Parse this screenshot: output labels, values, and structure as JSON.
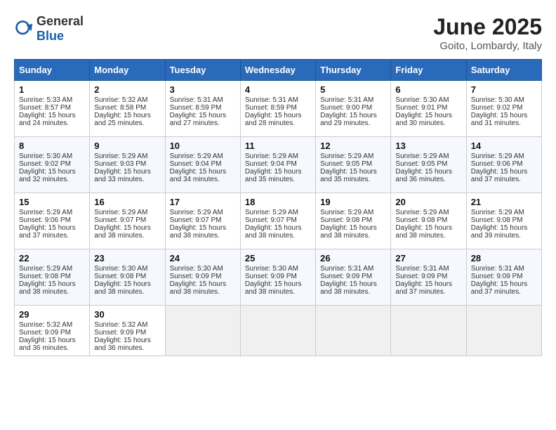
{
  "header": {
    "logo_general": "General",
    "logo_blue": "Blue",
    "month": "June 2025",
    "location": "Goito, Lombardy, Italy"
  },
  "days_of_week": [
    "Sunday",
    "Monday",
    "Tuesday",
    "Wednesday",
    "Thursday",
    "Friday",
    "Saturday"
  ],
  "weeks": [
    [
      {
        "day": "1",
        "lines": [
          "Sunrise: 5:33 AM",
          "Sunset: 8:57 PM",
          "Daylight: 15 hours",
          "and 24 minutes."
        ]
      },
      {
        "day": "2",
        "lines": [
          "Sunrise: 5:32 AM",
          "Sunset: 8:58 PM",
          "Daylight: 15 hours",
          "and 25 minutes."
        ]
      },
      {
        "day": "3",
        "lines": [
          "Sunrise: 5:31 AM",
          "Sunset: 8:59 PM",
          "Daylight: 15 hours",
          "and 27 minutes."
        ]
      },
      {
        "day": "4",
        "lines": [
          "Sunrise: 5:31 AM",
          "Sunset: 8:59 PM",
          "Daylight: 15 hours",
          "and 28 minutes."
        ]
      },
      {
        "day": "5",
        "lines": [
          "Sunrise: 5:31 AM",
          "Sunset: 9:00 PM",
          "Daylight: 15 hours",
          "and 29 minutes."
        ]
      },
      {
        "day": "6",
        "lines": [
          "Sunrise: 5:30 AM",
          "Sunset: 9:01 PM",
          "Daylight: 15 hours",
          "and 30 minutes."
        ]
      },
      {
        "day": "7",
        "lines": [
          "Sunrise: 5:30 AM",
          "Sunset: 9:02 PM",
          "Daylight: 15 hours",
          "and 31 minutes."
        ]
      }
    ],
    [
      {
        "day": "8",
        "lines": [
          "Sunrise: 5:30 AM",
          "Sunset: 9:02 PM",
          "Daylight: 15 hours",
          "and 32 minutes."
        ]
      },
      {
        "day": "9",
        "lines": [
          "Sunrise: 5:29 AM",
          "Sunset: 9:03 PM",
          "Daylight: 15 hours",
          "and 33 minutes."
        ]
      },
      {
        "day": "10",
        "lines": [
          "Sunrise: 5:29 AM",
          "Sunset: 9:04 PM",
          "Daylight: 15 hours",
          "and 34 minutes."
        ]
      },
      {
        "day": "11",
        "lines": [
          "Sunrise: 5:29 AM",
          "Sunset: 9:04 PM",
          "Daylight: 15 hours",
          "and 35 minutes."
        ]
      },
      {
        "day": "12",
        "lines": [
          "Sunrise: 5:29 AM",
          "Sunset: 9:05 PM",
          "Daylight: 15 hours",
          "and 35 minutes."
        ]
      },
      {
        "day": "13",
        "lines": [
          "Sunrise: 5:29 AM",
          "Sunset: 9:05 PM",
          "Daylight: 15 hours",
          "and 36 minutes."
        ]
      },
      {
        "day": "14",
        "lines": [
          "Sunrise: 5:29 AM",
          "Sunset: 9:06 PM",
          "Daylight: 15 hours",
          "and 37 minutes."
        ]
      }
    ],
    [
      {
        "day": "15",
        "lines": [
          "Sunrise: 5:29 AM",
          "Sunset: 9:06 PM",
          "Daylight: 15 hours",
          "and 37 minutes."
        ]
      },
      {
        "day": "16",
        "lines": [
          "Sunrise: 5:29 AM",
          "Sunset: 9:07 PM",
          "Daylight: 15 hours",
          "and 38 minutes."
        ]
      },
      {
        "day": "17",
        "lines": [
          "Sunrise: 5:29 AM",
          "Sunset: 9:07 PM",
          "Daylight: 15 hours",
          "and 38 minutes."
        ]
      },
      {
        "day": "18",
        "lines": [
          "Sunrise: 5:29 AM",
          "Sunset: 9:07 PM",
          "Daylight: 15 hours",
          "and 38 minutes."
        ]
      },
      {
        "day": "19",
        "lines": [
          "Sunrise: 5:29 AM",
          "Sunset: 9:08 PM",
          "Daylight: 15 hours",
          "and 38 minutes."
        ]
      },
      {
        "day": "20",
        "lines": [
          "Sunrise: 5:29 AM",
          "Sunset: 9:08 PM",
          "Daylight: 15 hours",
          "and 38 minutes."
        ]
      },
      {
        "day": "21",
        "lines": [
          "Sunrise: 5:29 AM",
          "Sunset: 9:08 PM",
          "Daylight: 15 hours",
          "and 39 minutes."
        ]
      }
    ],
    [
      {
        "day": "22",
        "lines": [
          "Sunrise: 5:29 AM",
          "Sunset: 9:08 PM",
          "Daylight: 15 hours",
          "and 38 minutes."
        ]
      },
      {
        "day": "23",
        "lines": [
          "Sunrise: 5:30 AM",
          "Sunset: 9:08 PM",
          "Daylight: 15 hours",
          "and 38 minutes."
        ]
      },
      {
        "day": "24",
        "lines": [
          "Sunrise: 5:30 AM",
          "Sunset: 9:09 PM",
          "Daylight: 15 hours",
          "and 38 minutes."
        ]
      },
      {
        "day": "25",
        "lines": [
          "Sunrise: 5:30 AM",
          "Sunset: 9:09 PM",
          "Daylight: 15 hours",
          "and 38 minutes."
        ]
      },
      {
        "day": "26",
        "lines": [
          "Sunrise: 5:31 AM",
          "Sunset: 9:09 PM",
          "Daylight: 15 hours",
          "and 38 minutes."
        ]
      },
      {
        "day": "27",
        "lines": [
          "Sunrise: 5:31 AM",
          "Sunset: 9:09 PM",
          "Daylight: 15 hours",
          "and 37 minutes."
        ]
      },
      {
        "day": "28",
        "lines": [
          "Sunrise: 5:31 AM",
          "Sunset: 9:09 PM",
          "Daylight: 15 hours",
          "and 37 minutes."
        ]
      }
    ],
    [
      {
        "day": "29",
        "lines": [
          "Sunrise: 5:32 AM",
          "Sunset: 9:09 PM",
          "Daylight: 15 hours",
          "and 36 minutes."
        ]
      },
      {
        "day": "30",
        "lines": [
          "Sunrise: 5:32 AM",
          "Sunset: 9:09 PM",
          "Daylight: 15 hours",
          "and 36 minutes."
        ]
      },
      {
        "day": "",
        "lines": []
      },
      {
        "day": "",
        "lines": []
      },
      {
        "day": "",
        "lines": []
      },
      {
        "day": "",
        "lines": []
      },
      {
        "day": "",
        "lines": []
      }
    ]
  ]
}
